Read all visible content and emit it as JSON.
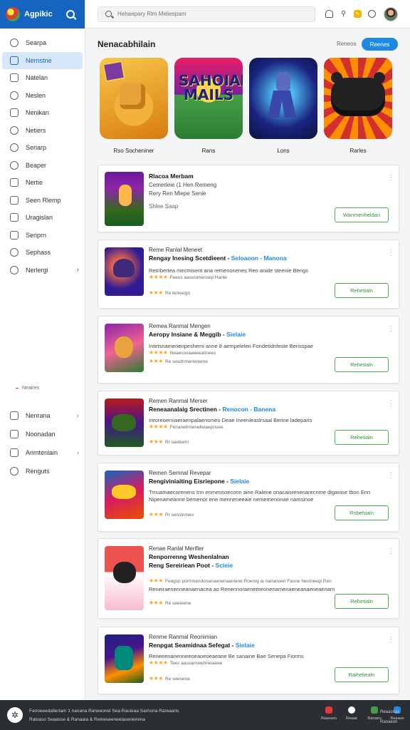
{
  "app": {
    "name": "Agpikic"
  },
  "colors": {
    "brand": "#1565c0",
    "accent": "#1e88e5",
    "action": "#4caf50",
    "star": "#f5a623",
    "footer": "#2b2e33"
  },
  "search": {
    "placeholder": "Hehaepary Rlm Meliespam"
  },
  "sidebar": {
    "items": [
      {
        "label": "Searpa",
        "icon": "compass-icon"
      },
      {
        "label": "Nernstne",
        "icon": "grid-icon"
      },
      {
        "label": "Natelan",
        "icon": "list-icon"
      },
      {
        "label": "Neslen",
        "icon": "bell-icon"
      },
      {
        "label": "Nenikan",
        "icon": "message-icon"
      },
      {
        "label": "Netiers",
        "icon": "people-icon"
      },
      {
        "label": "Seriarp",
        "icon": "gear-icon"
      },
      {
        "label": "Beaper",
        "icon": "drop-icon"
      },
      {
        "label": "Nertie",
        "icon": "folder-icon"
      },
      {
        "label": "Seen Rlemp",
        "icon": "card-icon"
      },
      {
        "label": "Uragislan",
        "icon": "calendar-icon"
      },
      {
        "label": "Seriprn",
        "icon": "grid-icon"
      },
      {
        "label": "Sephass",
        "icon": "cloud-icon"
      },
      {
        "label": "Nerlergi",
        "icon": "globe-icon"
      }
    ],
    "section_label": "Neaires",
    "bottom_items": [
      {
        "label": "Nenrana",
        "icon": "tag-icon"
      },
      {
        "label": "Noonadan",
        "icon": "image-icon"
      },
      {
        "label": "Arimtenlain",
        "icon": "briefcase-icon"
      },
      {
        "label": "Renguts",
        "icon": "user-icon"
      }
    ]
  },
  "featured": {
    "title": "Nenacabhilain",
    "link": "Reneos",
    "button": "Reenes",
    "tiles": [
      {
        "caption": "Rso Socheniner",
        "art": "sandbox-art"
      },
      {
        "caption": "Rans",
        "art": "title-art",
        "art_text": "SAHOIAR MAILS"
      },
      {
        "caption": "Lons",
        "art": "hero-art"
      },
      {
        "caption": "Rarles",
        "art": "controller-art"
      }
    ]
  },
  "cards": [
    {
      "title": "Rlacoa Merbam",
      "line1": "Cemerleie (1 Hen Remeng",
      "line2": "Rery Ren Mlepe Senie",
      "line3": "Shlee Saap",
      "button": "Wanmenheldan"
    },
    {
      "title": "Reme Ranlal Meneet",
      "headline": "Rengay Inesing Scetdieent",
      "tag": "Seloaoon - Manona",
      "desc": "Retribertea mecmisent ana remenonenes Ren anide steenie Bengs",
      "rating1": "Feeus aasssimeosep Hanle",
      "rating2": "Re teneeign",
      "button": "Rehetialn"
    },
    {
      "title": "Remea Ranmal Mengen",
      "headline": "Aeropy Insiane & Meggib",
      "tag": "Sielaie",
      "desc": "Intirtsnamenenpeshemi anne 8 aempelelen Fondetidnfeste Berisspae",
      "rating1": "Neaessnaaeeeatinees",
      "rating2": "Re sesdnmerieneme",
      "button": "Rehetialn"
    },
    {
      "title": "Remen Ranmal Merser",
      "headline": "Reneaanalaig Srectinen",
      "tag": "Renocon - Banena",
      "desc": "Ireoreoerniaeraenpalaensmeo Deae Ineenleaslrsaal Berine ladeparis",
      "rating1": "Fenanehmenelleiaepnsee",
      "rating2": "Rr seetiemi",
      "button": "Rehetialn"
    },
    {
      "title": "Remen Semnal Revepar",
      "headline": "Rengiviniaiting Eisriepone",
      "tag": "Sielaie",
      "desc": "Trnuamaecorenens Inn enmensoeconn aine Ralene onacaisrenenarecnme diganise tbon Enn",
      "desc2": "Nipenameanne bemenor ene menneneeaie nememenonae namsinoe",
      "rating2": "Rr senslnmeo",
      "button": "Rnbehialn"
    },
    {
      "title": "Renae Ranlal Merifier",
      "headline": "Renporrenng Weshenlalnan",
      "headline2": "Reng Sereiriean Poot",
      "tag": "Scleie",
      "desc": "Feagsp porrrinendonanaenenaaniene Roerog ai nananoen Fasne Necineegi Ren",
      "desc2": "Reneiraenenneanaenacea ao Renennoraenemeonenamenaeneanaeneaenarn",
      "rating2": "Re seeieene",
      "button": "Rehetialn"
    },
    {
      "title": "Renme Ranmal Reonimian",
      "headline": "Renpgat Seamidnaa Sefegat",
      "tag": "Sielaie",
      "desc": "Reneeenanenneeoeaoeoeaeane Be sanaine Bae Senepa Fiorms",
      "rating1": "Tees aassarnewnneiaeee",
      "rating2": "Re seesena",
      "button": "Raiheliealn"
    }
  ],
  "footer": {
    "line1": "Fanoeeedallertam 1 nanana Raneeonel Sea Raoieaa Sarriona Rareaans",
    "line2": "Raloaso Seaasse & Ranaaia & Reineseeneeiaseneirena",
    "apps": [
      {
        "label": "Raaeaso",
        "color": "#e53935"
      },
      {
        "label": "Reaae",
        "color": "#ffffff"
      },
      {
        "label": "Raoaeo",
        "color": "#43a047"
      },
      {
        "label": "Reaaoe",
        "color": "#1e88e5"
      }
    ],
    "right_top": "Reaaosas",
    "right_bottom": "Raoaeon"
  }
}
